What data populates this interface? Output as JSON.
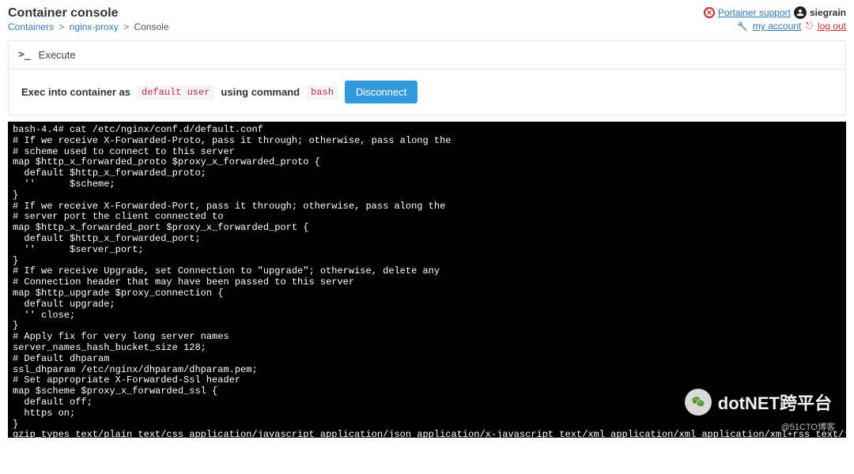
{
  "header": {
    "title": "Container console",
    "support_label": "Portainer support",
    "username": "siegrain",
    "my_account_label": "my account",
    "logout_label": "log out"
  },
  "breadcrumb": {
    "items": [
      {
        "label": "Containers",
        "link": true
      },
      {
        "label": "nginx-proxy",
        "link": true
      },
      {
        "label": "Console",
        "link": false
      }
    ],
    "sep": ">"
  },
  "panel": {
    "header_label": "Execute",
    "exec_prefix": "Exec into container as",
    "default_user": "default user",
    "using_command": "using command",
    "command": "bash",
    "disconnect_label": "Disconnect"
  },
  "terminal": {
    "content": "bash-4.4# cat /etc/nginx/conf.d/default.conf\n# If we receive X-Forwarded-Proto, pass it through; otherwise, pass along the\n# scheme used to connect to this server\nmap $http_x_forwarded_proto $proxy_x_forwarded_proto {\n  default $http_x_forwarded_proto;\n  ''      $scheme;\n}\n# If we receive X-Forwarded-Port, pass it through; otherwise, pass along the\n# server port the client connected to\nmap $http_x_forwarded_port $proxy_x_forwarded_port {\n  default $http_x_forwarded_port;\n  ''      $server_port;\n}\n# If we receive Upgrade, set Connection to \"upgrade\"; otherwise, delete any\n# Connection header that may have been passed to this server\nmap $http_upgrade $proxy_connection {\n  default upgrade;\n  '' close;\n}\n# Apply fix for very long server names\nserver_names_hash_bucket_size 128;\n# Default dhparam\nssl_dhparam /etc/nginx/dhparam/dhparam.pem;\n# Set appropriate X-Forwarded-Ssl header\nmap $scheme $proxy_x_forwarded_ssl {\n  default off;\n  https on;\n}\ngzip_types text/plain text/css application/javascript application/json application/x-javascript text/xml application/xml application/xml+rss text/javascript;"
  },
  "watermark": {
    "text": "dotNET跨平台",
    "footer": "@51CTO博客"
  }
}
